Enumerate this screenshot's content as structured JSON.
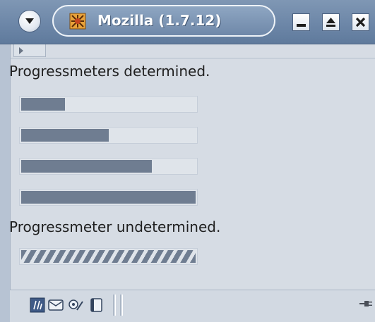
{
  "window": {
    "title": "Mozilla (1.7.12)"
  },
  "content": {
    "determined_heading": "Progressmeters determined.",
    "determined_meters": [
      {
        "progress": 0.25
      },
      {
        "progress": 0.5
      },
      {
        "progress": 0.75
      },
      {
        "progress": 1.0
      }
    ],
    "undetermined_heading": "Progressmeter undetermined.",
    "undetermined_meter": {
      "mode": "undetermined"
    }
  },
  "statusbar": {
    "icons": [
      "navigator-icon",
      "mail-icon",
      "composer-icon",
      "address-book-icon"
    ],
    "right_icon": "online-plug-icon"
  },
  "colors": {
    "titlebar": "#6d87a8",
    "client_bg": "#d6dce4",
    "meter_fill": "#6f7d91"
  }
}
